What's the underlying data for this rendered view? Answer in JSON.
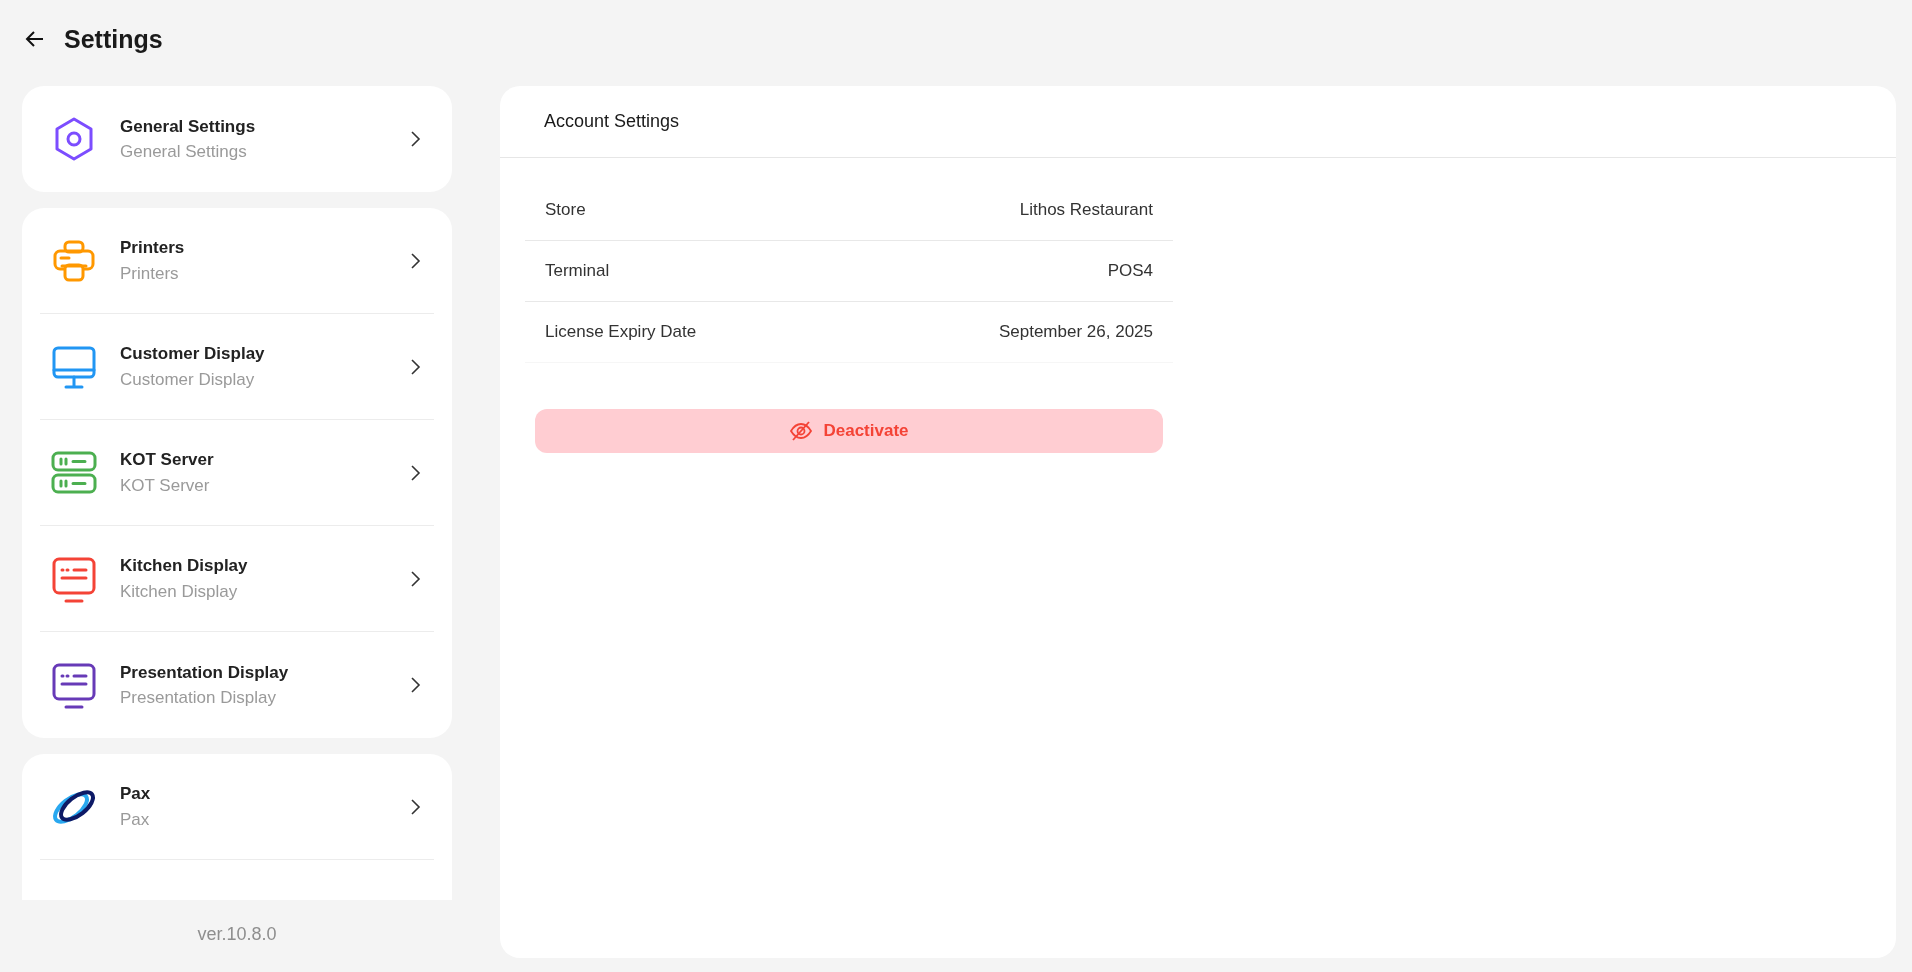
{
  "header": {
    "title": "Settings"
  },
  "sidebar": {
    "groups": [
      {
        "items": [
          {
            "kind": "hexagon",
            "color": "#7c4dff",
            "title": "General Settings",
            "subtitle": "General Settings"
          }
        ]
      },
      {
        "items": [
          {
            "kind": "printer",
            "color": "#ff9800",
            "title": "Printers",
            "subtitle": "Printers"
          },
          {
            "kind": "monitor",
            "color": "#2196f3",
            "title": "Customer Display",
            "subtitle": "Customer Display"
          },
          {
            "kind": "server",
            "color": "#4caf50",
            "title": "KOT Server",
            "subtitle": "KOT Server"
          },
          {
            "kind": "display",
            "color": "#f44336",
            "title": "Kitchen Display",
            "subtitle": "Kitchen Display"
          },
          {
            "kind": "display",
            "color": "#673ab7",
            "title": "Presentation Display",
            "subtitle": "Presentation Display"
          }
        ]
      },
      {
        "items": [
          {
            "kind": "logo",
            "title": "Pax",
            "subtitle": "Pax"
          }
        ]
      }
    ]
  },
  "version": "ver.10.8.0",
  "panel": {
    "title": "Account Settings",
    "rows": [
      {
        "label": "Store",
        "value": "Lithos Restaurant"
      },
      {
        "label": "Terminal",
        "value": "POS4"
      },
      {
        "label": "License Expiry Date",
        "value": "September 26, 2025"
      }
    ],
    "button": {
      "label": "Deactivate"
    }
  }
}
